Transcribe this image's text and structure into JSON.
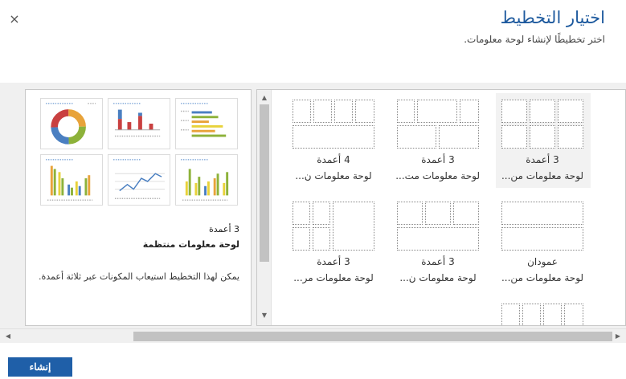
{
  "dialog": {
    "title": "اختيار التخطيط",
    "subtitle": "اختر تخطيطًا لإنشاء لوحة معلومات.",
    "close_glyph": "×"
  },
  "preview": {
    "layout_title": "3 أعمدة",
    "layout_name": "لوحة معلومات منتظمة",
    "description": "يمكن لهذا التخطيط استيعاب المكونات عبر ثلاثة أعمدة."
  },
  "layouts": [
    {
      "title": "3 أعمدة",
      "name": "لوحة معلومات من...",
      "selected": true
    },
    {
      "title": "3 أعمدة",
      "name": "لوحة معلومات مت...",
      "selected": false
    },
    {
      "title": "4 أعمدة",
      "name": "لوحة معلومات ن...",
      "selected": false
    },
    {
      "title": "عمودان",
      "name": "لوحة معلومات من...",
      "selected": false
    },
    {
      "title": "3 أعمدة",
      "name": "لوحة معلومات ن...",
      "selected": false
    },
    {
      "title": "3 أعمدة",
      "name": "لوحة معلومات مر...",
      "selected": false
    }
  ],
  "scrollbars": {
    "up_arrow": "▲",
    "down_arrow": "▼",
    "left_arrow": "◀",
    "right_arrow": "▶"
  },
  "footer": {
    "create_label": "إنشاء"
  },
  "colors": {
    "accent": "#1f5fa8",
    "title": "#1e5a9e"
  },
  "icons": [
    "close-icon",
    "donut-chart-icon",
    "column-chart-icon",
    "bar-chart-icon",
    "stacked-column-chart-icon",
    "line-chart-icon"
  ]
}
